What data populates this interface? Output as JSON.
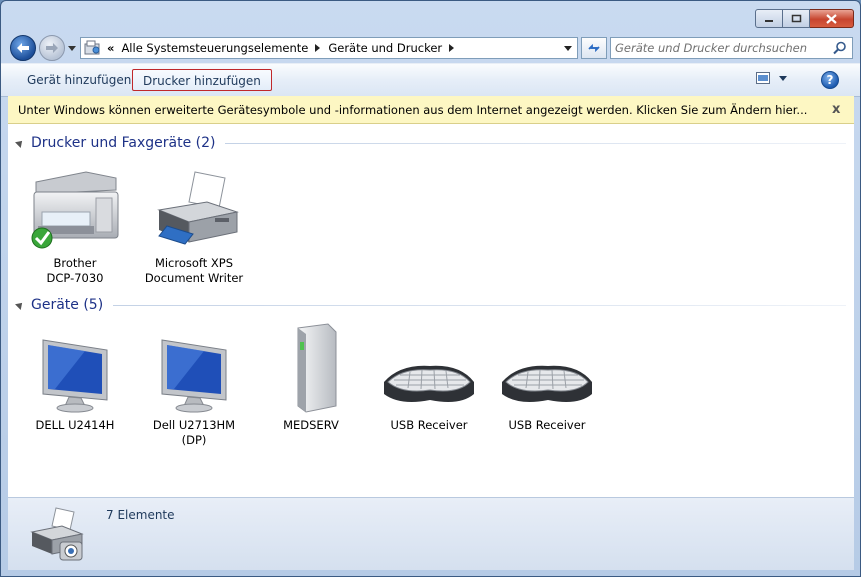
{
  "address": {
    "chevron": "«",
    "crumbs": [
      "Alle Systemsteuerungselemente",
      "Geräte und Drucker"
    ]
  },
  "search": {
    "placeholder": "Geräte und Drucker durchsuchen"
  },
  "toolbar": {
    "add_device": "Gerät hinzufügen",
    "add_printer": "Drucker hinzufügen",
    "help": "?"
  },
  "infobar": {
    "text": "Unter Windows können erweiterte Gerätesymbole und -informationen aus dem Internet angezeigt werden. Klicken Sie zum Ändern hier...",
    "close": "x"
  },
  "groups": {
    "printers": {
      "title": "Drucker und Faxgeräte (2)",
      "items": [
        {
          "label_line1": "Brother",
          "label_line2": "DCP-7030",
          "icon": "multifunction-printer-icon",
          "default": true
        },
        {
          "label_line1": "Microsoft XPS",
          "label_line2": "Document Writer",
          "icon": "printer-icon"
        }
      ]
    },
    "devices": {
      "title": "Geräte (5)",
      "items": [
        {
          "label_line1": "DELL U2414H",
          "label_line2": "",
          "icon": "monitor-icon"
        },
        {
          "label_line1": "Dell U2713HM",
          "label_line2": "(DP)",
          "icon": "monitor-icon"
        },
        {
          "label_line1": "MEDSERV",
          "label_line2": "",
          "icon": "computer-tower-icon"
        },
        {
          "label_line1": "USB Receiver",
          "label_line2": "",
          "icon": "keyboard-icon"
        },
        {
          "label_line1": "USB Receiver",
          "label_line2": "",
          "icon": "keyboard-icon"
        }
      ]
    }
  },
  "status": {
    "count": "7 Elemente",
    "icon": "devices-printers-icon"
  },
  "colors": {
    "accent": "#1e3287",
    "infobar": "#fdf7c3",
    "highlight_border": "#c0282b"
  }
}
